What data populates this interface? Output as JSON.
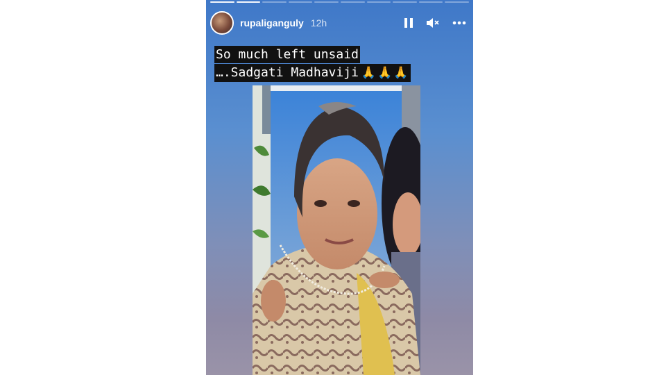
{
  "story": {
    "progress": {
      "total_segments": 10,
      "completed_segments": 2
    },
    "header": {
      "username": "rupaliganguly",
      "time_ago": "12h",
      "avatar_icon": "profile-avatar",
      "pause_icon": "pause-icon",
      "mute_icon": "speaker-muted-icon",
      "more_icon": "more-options-icon"
    },
    "caption": {
      "line1": "So much left unsaid",
      "line2": "….Sadgati Madhaviji",
      "emoji": "🙏🙏🙏"
    },
    "colors": {
      "background_top": "#3f78c8",
      "background_bottom": "#9a93a8",
      "caption_highlight": "#111111",
      "text": "#ffffff"
    }
  }
}
